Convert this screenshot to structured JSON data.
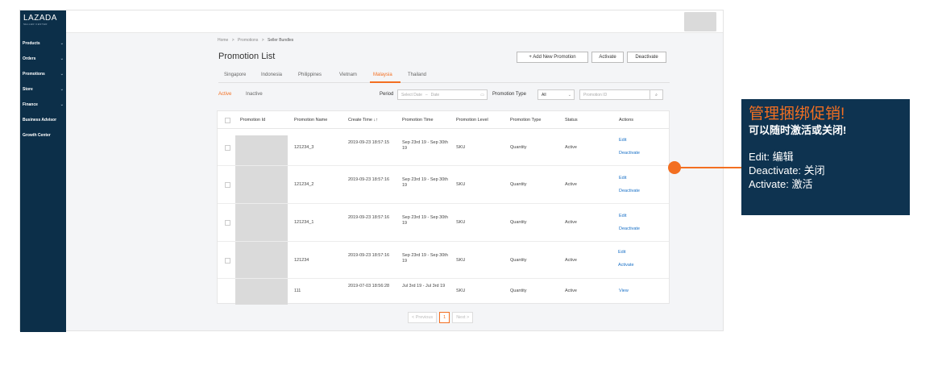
{
  "sidebar": {
    "logo_main": "LAZADA",
    "logo_sub": "SELLER CENTER",
    "items": [
      {
        "label": "Products"
      },
      {
        "label": "Orders"
      },
      {
        "label": "Promotions"
      },
      {
        "label": "Store"
      },
      {
        "label": "Finance"
      },
      {
        "label": "Business Advisor"
      },
      {
        "label": "Growth Center"
      }
    ]
  },
  "breadcrumb": [
    "Home",
    ">",
    "Promotions",
    ">",
    "Seller Bundles"
  ],
  "page_title": "Promotion List",
  "toolbar": {
    "add_label": "+ Add New Promotion",
    "activate_label": "Activate",
    "deactivate_label": "Deactivate"
  },
  "country_tabs": [
    {
      "label": "Singapore"
    },
    {
      "label": "Indonesia"
    },
    {
      "label": "Philippines"
    },
    {
      "label": "Vietnam"
    },
    {
      "label": "Malaysia",
      "active": true
    },
    {
      "label": "Thailand"
    }
  ],
  "status_tabs": [
    {
      "label": "Active",
      "active": true
    },
    {
      "label": "Inactive"
    }
  ],
  "filters": {
    "period_label": "Period",
    "start_placeholder": "Select Date",
    "end_placeholder": "Date",
    "type_label": "Promotion Type",
    "type_value": "All",
    "id_placeholder": "Promotion ID"
  },
  "table": {
    "headers": [
      "Promotion Id",
      "Promotion Name",
      "Create Time ↓↑",
      "Promotion Time",
      "Promotion Level",
      "Promotion Type",
      "Status",
      "Actions"
    ],
    "rows": [
      {
        "name": "121234_3",
        "create": "2019-09-23 18:57:15",
        "time": "Sep 23rd 19 - Sep 30th 19",
        "level": "SKU",
        "type": "Quantity",
        "status": "Active",
        "action1": "Edit",
        "action2": "Deactivate"
      },
      {
        "name": "121234_2",
        "create": "2019-09-23 18:57:16",
        "time": "Sep 23rd 19 - Sep 30th 19",
        "level": "SKU",
        "type": "Quantity",
        "status": "Active",
        "action1": "Edit",
        "action2": "Deactivate"
      },
      {
        "name": "121234_1",
        "create": "2019-09-23 18:57:16",
        "time": "Sep 23rd 19 - Sep 30th 19",
        "level": "SKU",
        "type": "Quantity",
        "status": "Active",
        "action1": "Edit",
        "action2": "Deactivate"
      },
      {
        "name": "121234",
        "create": "2019-09-23 18:57:16",
        "time": "Sep 23rd 19 - Sep 30th 19",
        "level": "SKU",
        "type": "Quantity",
        "status": "Active",
        "action1": "Edit",
        "action2": "Activate"
      },
      {
        "name": "111",
        "create": "2019-07-03 18:56:28",
        "time": "Jul 3rd 19 - Jul 3rd 19",
        "level": "SKU",
        "type": "Quantity",
        "status": "Active",
        "action1": "View",
        "action2": ""
      }
    ]
  },
  "pagination": {
    "prev": "< Previous",
    "current": "1",
    "next": "Next >"
  },
  "callout": {
    "title": "管理捆绑促销!",
    "subtitle": "可以随时激活或关闭!",
    "lines": [
      "Edit: 编辑",
      "Deactivate: 关闭",
      "Activate: 激活"
    ]
  },
  "colors": {
    "accent": "#f36f21",
    "sidebar": "#0c2f49",
    "callout_bg": "#0e3350",
    "link": "#1a71c7"
  }
}
